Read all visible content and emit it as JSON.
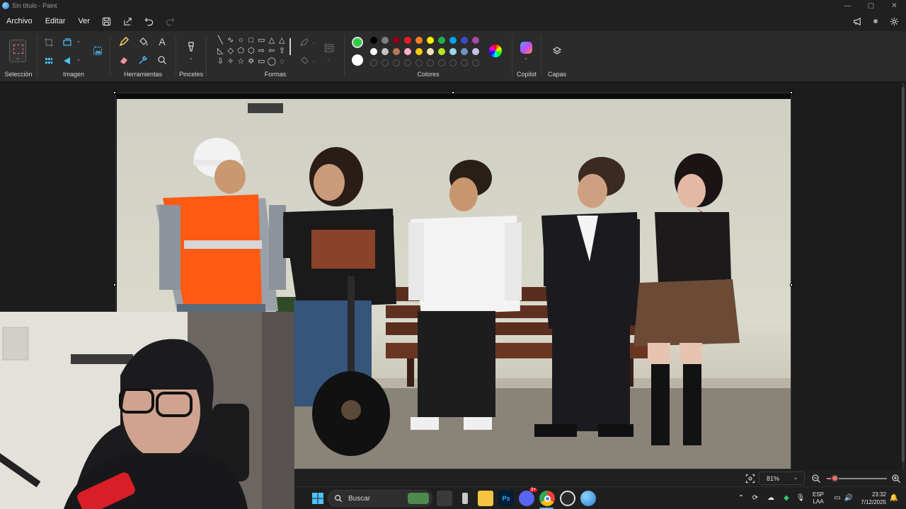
{
  "window": {
    "title": "Sin título - Paint",
    "controls": {
      "minimize": "—",
      "maximize": "▢",
      "close": "✕"
    }
  },
  "menu": {
    "items": [
      "Archivo",
      "Editar",
      "Ver"
    ],
    "quick_actions": [
      "save-icon",
      "share-icon",
      "undo-icon",
      "redo-icon"
    ]
  },
  "topright": [
    "announce-icon",
    "account-icon",
    "settings-icon"
  ],
  "ribbon": {
    "groups": {
      "seleccion": "Selección",
      "imagen": "Imagen",
      "herramientas": "Herramientas",
      "pinceles": "Pinceles",
      "formas": "Formas",
      "colores": "Colores",
      "copilot": "Copilot",
      "capas": "Capas"
    },
    "shapes": [
      "╲",
      "∿",
      "○",
      "□",
      "▭",
      "△",
      "△",
      "◺",
      "◇",
      "⬠",
      "⬡",
      "⇨",
      "⇦",
      "⇧",
      "⇩",
      "✧",
      "☆",
      "✡",
      "▭",
      "◯",
      "◌",
      "⌒"
    ],
    "colors": {
      "primary": "#2ecc40",
      "secondary": "#ffffff",
      "row1": [
        "#000000",
        "#7f7f7f",
        "#880015",
        "#ed1c24",
        "#ff7f27",
        "#fff200",
        "#22b14c",
        "#00a2e8",
        "#3f48cc",
        "#a349a4"
      ],
      "row2": [
        "#ffffff",
        "#c3c3c3",
        "#b97a57",
        "#ffaec9",
        "#ffc90e",
        "#efe4b0",
        "#b5e61d",
        "#99d9ea",
        "#7092be",
        "#c8bfe7"
      ],
      "row3_empty": 10
    }
  },
  "status": {
    "zoom": "81%",
    "zoom_level": 0.12
  },
  "taskbar": {
    "search_placeholder": "Buscar",
    "apps": [
      "start-icon",
      "search",
      "widget",
      "task-view-icon",
      "app-icon",
      "file-explorer-icon",
      "photoshop-icon",
      "discord-icon",
      "chrome-icon",
      "obs-icon",
      "paint-icon"
    ],
    "photoshop_label": "Ps",
    "discord_badge": "2+",
    "lang_top": "ESP",
    "lang_bottom": "LAA",
    "time": "23:32",
    "date": "7/12/2025"
  }
}
